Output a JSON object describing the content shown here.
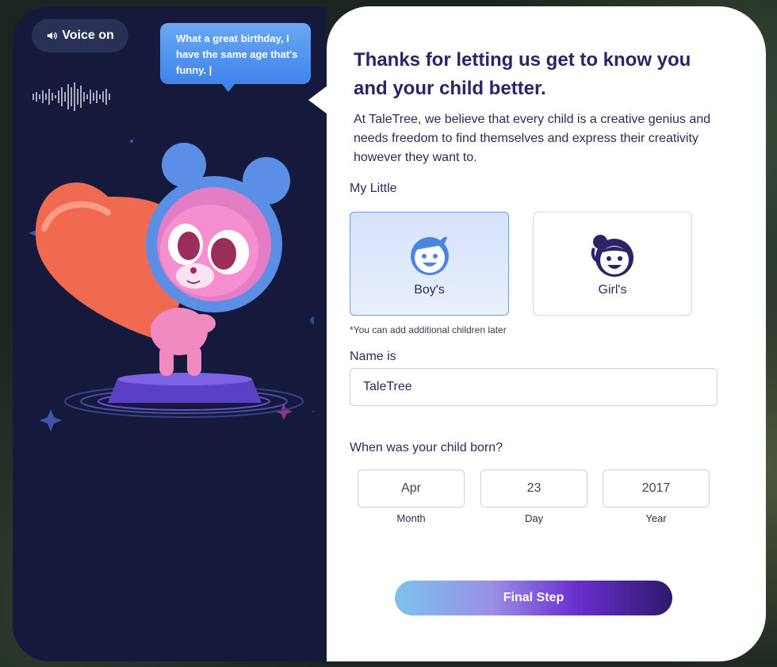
{
  "voice": {
    "label": "Voice on",
    "icon": "speaker-icon"
  },
  "bubble": {
    "text": "What a great birthday, I have the same age that's funny. |"
  },
  "form": {
    "title": "Thanks for letting us get to know you and your child better.",
    "intro": "At TaleTree, we believe that every child is a creative genius and needs freedom to find themselves and express their creativity however they want to.",
    "my_little_label": "My Little",
    "options": [
      {
        "label": "Boy's",
        "icon": "boy-face-icon",
        "selected": true
      },
      {
        "label": "Girl's",
        "icon": "girl-face-icon",
        "selected": false
      }
    ],
    "note": "*You can add additional children later",
    "name_label": "Name is",
    "name_value": "TaleTree",
    "born_label": "When was your child born?",
    "month": {
      "value": "Apr",
      "label": "Month"
    },
    "day": {
      "value": "23",
      "label": "Day"
    },
    "year": {
      "value": "2017",
      "label": "Year"
    },
    "submit_label": "Final Step"
  },
  "colors": {
    "left_bg": "#151a3c",
    "title": "#2d2366",
    "bubble": "#4a8eee",
    "selected_border": "#6f9de4"
  }
}
